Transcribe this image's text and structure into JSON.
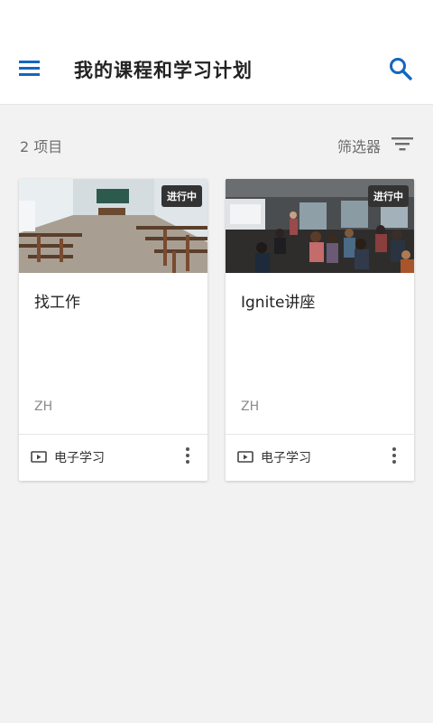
{
  "header": {
    "title": "我的课程和学习计划",
    "menu_icon": "menu-icon",
    "search_icon": "search-icon",
    "accent_color": "#1565c0"
  },
  "toolbar": {
    "count_label": "2 项目",
    "filter_label": "筛选器",
    "filter_icon": "filter-icon"
  },
  "cards": [
    {
      "title": "找工作",
      "status_badge": "进行中",
      "language": "ZH",
      "type_label": "电子学习",
      "type_icon": "video-icon",
      "image": "classroom-image"
    },
    {
      "title": "Ignite讲座",
      "status_badge": "进行中",
      "language": "ZH",
      "type_label": "电子学习",
      "type_icon": "video-icon",
      "image": "lecture-audience-image"
    }
  ]
}
